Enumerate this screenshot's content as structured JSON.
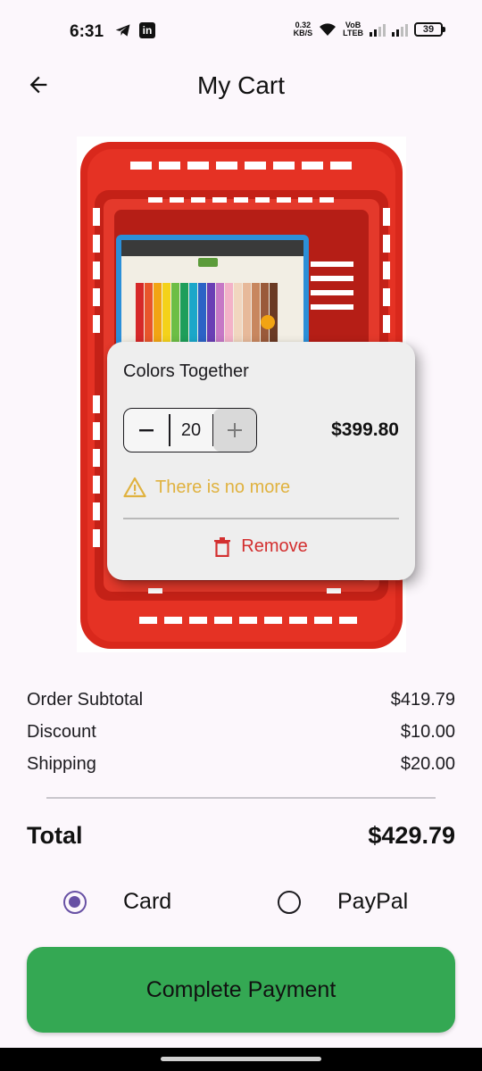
{
  "status_bar": {
    "time": "6:31",
    "net_speed_value": "0.32",
    "net_speed_unit": "KB/S",
    "volte_top": "VoB",
    "volte_bottom": "LTEB",
    "battery": "39"
  },
  "header": {
    "title": "My Cart",
    "back_icon": "arrow-left-icon"
  },
  "cart_item": {
    "name": "Colors Together",
    "quantity": "20",
    "price": "$399.80",
    "warning": "There is no more",
    "remove_label": "Remove",
    "warning_color": "#E0B23F",
    "remove_color": "#D32F2F"
  },
  "summary": {
    "rows": [
      {
        "label": "Order Subtotal",
        "value": "$419.79"
      },
      {
        "label": "Discount",
        "value": "$10.00"
      },
      {
        "label": "Shipping",
        "value": "$20.00"
      }
    ],
    "total_label": "Total",
    "total_value": "$429.79"
  },
  "payment": {
    "options": [
      {
        "label": "Card",
        "selected": true
      },
      {
        "label": "PayPal",
        "selected": false
      }
    ],
    "accent": "#6750A4"
  },
  "complete_button": {
    "label": "Complete Payment",
    "color": "#34A853"
  }
}
